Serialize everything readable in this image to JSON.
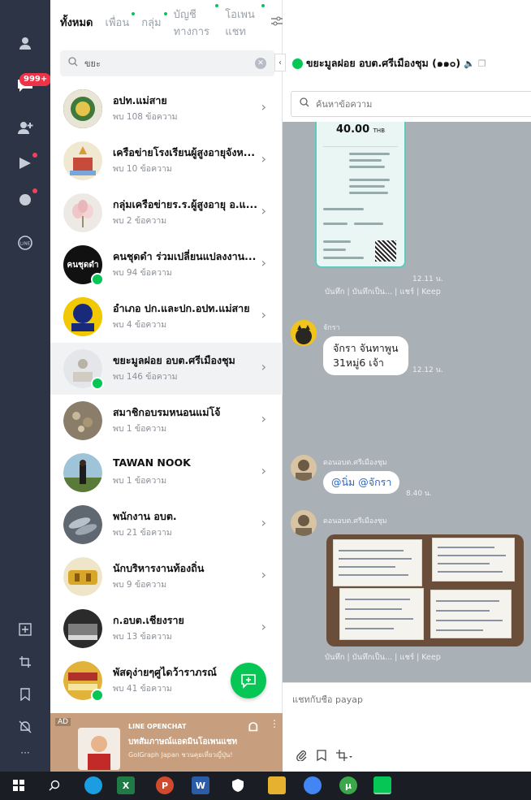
{
  "rail": {
    "badge": "999+"
  },
  "tabs": [
    {
      "label": "ทั้งหมด"
    },
    {
      "label": "เพื่อน"
    },
    {
      "label": "กลุ่ม"
    },
    {
      "label": "บัญชีทางการ"
    },
    {
      "label": "โอเพนแชท"
    }
  ],
  "search": {
    "value": "ขยะ"
  },
  "chats": [
    {
      "name": "อปท.แม่สาย",
      "sub": "พบ 108 ข้อความ"
    },
    {
      "name": "เครือข่ายโรงเรียนผู้สูงอายุจังห...",
      "sub": "พบ 10 ข้อความ"
    },
    {
      "name": "กลุ่มเครือข่ายร.ร.ผู้สูงอายุ อ.แ...",
      "sub": "พบ 2 ข้อความ"
    },
    {
      "name": "คนชุดดำ ร่วมเปลี่ยนแปลงงาน...",
      "sub": "พบ 94 ข้อความ",
      "avatar_text": "คนชุดดำ"
    },
    {
      "name": "อำเภอ ปก.และปก.อปท.แม่สาย",
      "sub": "พบ 4 ข้อความ",
      "avatar_text": "ปก"
    },
    {
      "name": "ขยะมูลฝอย อบต.ศรีเมืองชุม",
      "sub": "พบ 146 ข้อความ"
    },
    {
      "name": "สมาชิกอบรมหนอนแม่โจ้",
      "sub": "พบ 1 ข้อความ"
    },
    {
      "name": "TAWAN NOOK",
      "sub": "พบ 1 ข้อความ"
    },
    {
      "name": "พนักงาน อบต.",
      "sub": "พบ 21 ข้อความ"
    },
    {
      "name": "นักบริหารงานท้องถิ่น",
      "sub": "พบ 9 ข้อความ"
    },
    {
      "name": "ก.อบต.เชียงราย",
      "sub": "พบ 13 ข้อความ"
    },
    {
      "name": "พัสดุง่ายๆศูไดว้าราภรณ์",
      "sub": "พบ 41 ข้อความ"
    }
  ],
  "ad": {
    "tag": "AD",
    "line1": "LINE OPENCHAT",
    "line2": "บทสัมภาษณ์แอดมินโอเพนแชท",
    "line3": "GoIGraph Japan ชวนคุยเที่ยวญี่ปุ่น!"
  },
  "chat": {
    "title": "ขยะมูลฝอย อบต.ศรีเมืองชุม (๑๑๐)",
    "search_placeholder": "ค้นหาข้อความ",
    "receipt_amount": "40.00",
    "receipt_currency": "THB",
    "receipt_time": "12.11 น.",
    "receipt_actions": "บันทึก | บันทึกเป็น... | แชร์ | Keep",
    "msg1_sender": "จักรา",
    "msg1_text_1": "จักรา จันทาพูน",
    "msg1_text_2": "31หมู่6 เจ้า",
    "msg1_time": "12.12 น.",
    "msg2_sender": "ดอนอบต.ศรีเมืองชุม",
    "msg2_mention": "@นิ่ม @จักรา",
    "msg2_time": "8.40 น.",
    "msg3_sender": "ดอนอบต.ศรีเมืองชุม",
    "photo_actions": "บันทึก | บันทึกเป็น... | แชร์ | Keep",
    "input_placeholder": "แชทกับชื่อ payap"
  }
}
